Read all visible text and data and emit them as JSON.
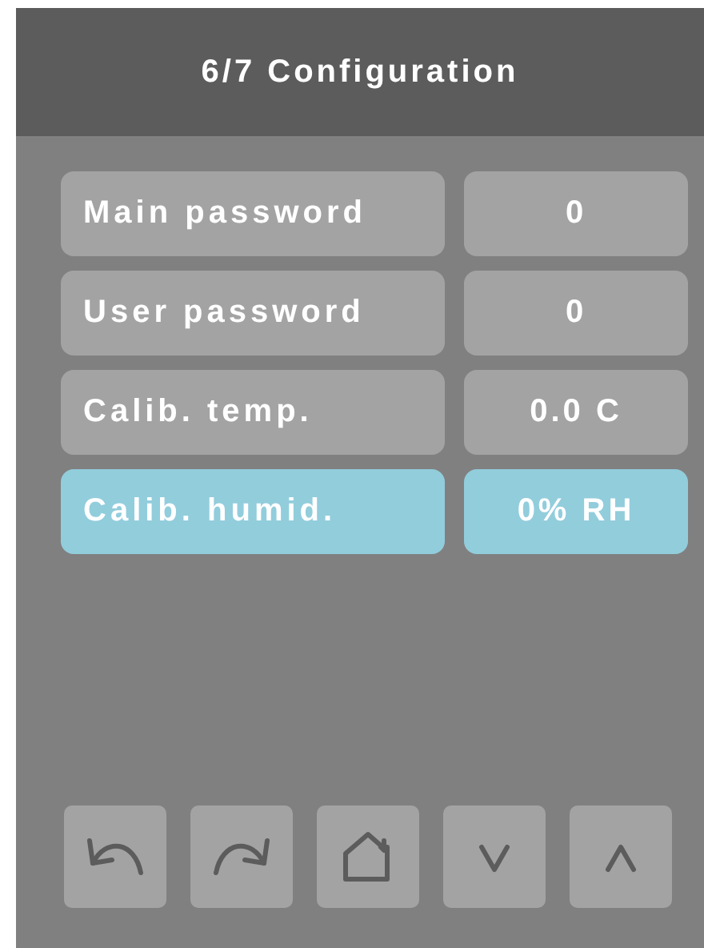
{
  "header": {
    "title": "6/7 Configuration"
  },
  "settings": [
    {
      "label": "Main password",
      "value": "0",
      "selected": false
    },
    {
      "label": "User password",
      "value": "0",
      "selected": false
    },
    {
      "label": "Calib. temp.",
      "value": "0.0 C",
      "selected": false
    },
    {
      "label": "Calib. humid.",
      "value": "0% RH",
      "selected": true
    }
  ],
  "nav_buttons": [
    {
      "kind": "back"
    },
    {
      "kind": "forward"
    },
    {
      "kind": "home"
    },
    {
      "kind": "down"
    },
    {
      "kind": "up"
    }
  ]
}
